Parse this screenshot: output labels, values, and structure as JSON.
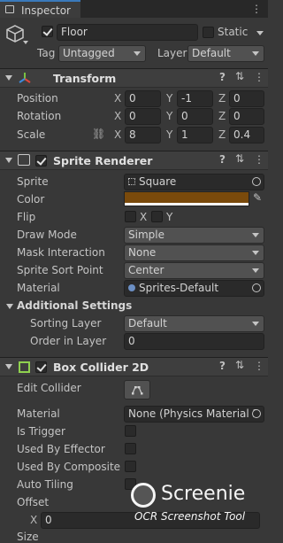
{
  "tab": {
    "label": "Inspector"
  },
  "object": {
    "name": "Floor",
    "static_label": "Static",
    "tag_label": "Tag",
    "tag_value": "Untagged",
    "layer_label": "Layer",
    "layer_value": "Default"
  },
  "transform": {
    "title": "Transform",
    "position": {
      "label": "Position",
      "x": "0",
      "y": "-1",
      "z": "0"
    },
    "rotation": {
      "label": "Rotation",
      "x": "0",
      "y": "0",
      "z": "0"
    },
    "scale": {
      "label": "Scale",
      "x": "8",
      "y": "1",
      "z": "0.4"
    },
    "axis_x": "X",
    "axis_y": "Y",
    "axis_z": "Z"
  },
  "sprite_renderer": {
    "title": "Sprite Renderer",
    "sprite": {
      "label": "Sprite",
      "value": "Square"
    },
    "color": {
      "label": "Color",
      "value": "#7a4a0b"
    },
    "flip": {
      "label": "Flip",
      "x": "X",
      "y": "Y"
    },
    "draw_mode": {
      "label": "Draw Mode",
      "value": "Simple"
    },
    "mask_interaction": {
      "label": "Mask Interaction",
      "value": "None"
    },
    "sort_point": {
      "label": "Sprite Sort Point",
      "value": "Center"
    },
    "material": {
      "label": "Material",
      "value": "Sprites-Default"
    },
    "additional": {
      "title": "Additional Settings",
      "sorting_layer": {
        "label": "Sorting Layer",
        "value": "Default"
      },
      "order_in_layer": {
        "label": "Order in Layer",
        "value": "0"
      }
    }
  },
  "box_collider": {
    "title": "Box Collider 2D",
    "edit_collider": {
      "label": "Edit Collider"
    },
    "material": {
      "label": "Material",
      "value": "None (Physics Material 2"
    },
    "is_trigger": {
      "label": "Is Trigger"
    },
    "used_by_effector": {
      "label": "Used By Effector"
    },
    "used_by_composite": {
      "label": "Used By Composite"
    },
    "auto_tiling": {
      "label": "Auto Tiling"
    },
    "offset": {
      "label": "Offset",
      "x_axis": "X",
      "x": "0"
    },
    "size": {
      "label": "Size"
    }
  },
  "watermark": {
    "name": "Screenie",
    "caption": "OCR Screenshot Tool"
  }
}
